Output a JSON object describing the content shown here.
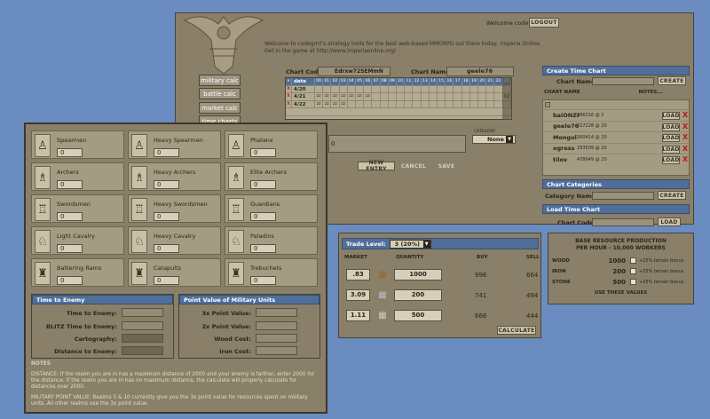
{
  "header": {
    "welcome_code_label": "Welcome code",
    "logout_label": "LOGOUT",
    "intro_line1": "Welcome to codegrrrl's strategy tools for the best web-based MMORPG out there today, Imperia Online.",
    "intro_line2": "Get in the game at http://www.imperiaonline.org/"
  },
  "nav": {
    "items": [
      "military calc",
      "battle calc",
      "market calc",
      "time charts"
    ]
  },
  "chart_editor": {
    "chart_code_label": "Chart Code:",
    "chart_code_value": "Edrxw72SEMmN",
    "chart_name_label": "Chart Name:",
    "chart_name_value": "geele76",
    "grid_head_x": "x",
    "grid_head_date": "date",
    "hours": [
      "00",
      "01",
      "02",
      "03",
      "04",
      "05",
      "06",
      "07",
      "08",
      "09",
      "10",
      "11",
      "12",
      "13",
      "14",
      "15",
      "16",
      "17",
      "18",
      "19",
      "20",
      "21",
      "22",
      "23"
    ],
    "rows": [
      {
        "date": "4/20",
        "marks": "",
        "note": ""
      },
      {
        "date": "4/21",
        "marks": "ZZZZZZZ",
        "note": "12"
      },
      {
        "date": "4/22",
        "marks": "ZZZZ",
        "note": ""
      }
    ],
    "notes_value": "0",
    "category_label": "CATEGORY",
    "category_value": "None",
    "new_entry_label": "NEW ENTRY",
    "cancel_label": "CANCEL",
    "save_label": "SAVE"
  },
  "time_chart_panel": {
    "create_title": "Create Time Chart",
    "chart_name_label": "Chart Name:",
    "create_label": "CREATE",
    "col_chart_name": "CHART NAME",
    "col_notes": "NOTES...",
    "load_label": "LOAD",
    "charts": [
      {
        "name": "baiONZI",
        "value": "486316 @ 2"
      },
      {
        "name": "geele76",
        "value": "227228 @ 20"
      },
      {
        "name": "Mongol",
        "value": "260414 @ 20"
      },
      {
        "name": "ogress",
        "value": "183509 @ 20"
      },
      {
        "name": "tilov",
        "value": "478049 @ 20"
      }
    ],
    "categories_title": "Chart Categories",
    "category_name_label": "Category Name:",
    "load_title": "Load Time Chart",
    "chart_code_label": "Chart Code:"
  },
  "military": {
    "units": [
      {
        "name": "Spearmen",
        "value": "0"
      },
      {
        "name": "Heavy Spearmen",
        "value": "0"
      },
      {
        "name": "Phalanx",
        "value": "0"
      },
      {
        "name": "Archers",
        "value": "0"
      },
      {
        "name": "Heavy Archers",
        "value": "0"
      },
      {
        "name": "Elite Archers",
        "value": "0"
      },
      {
        "name": "Swordsmen",
        "value": "0"
      },
      {
        "name": "Heavy Swordsmen",
        "value": "0"
      },
      {
        "name": "Guardians",
        "value": "0"
      },
      {
        "name": "Light Cavalry",
        "value": "0"
      },
      {
        "name": "Heavy Cavalry",
        "value": "0"
      },
      {
        "name": "Paladins",
        "value": "0"
      },
      {
        "name": "Battering Rams",
        "value": "0"
      },
      {
        "name": "Catapults",
        "value": "0"
      },
      {
        "name": "Trebuchets",
        "value": "0"
      }
    ],
    "time_title": "Time to Enemy",
    "time_labels": [
      "Time to Enemy:",
      "BLITZ Time to Enemy:",
      "Cartography:",
      "Distance to Enemy:"
    ],
    "points_title": "Point Value of Military Units",
    "points_labels": [
      "3x Point Value:",
      "2x Point Value:",
      "Wood Cost:",
      "Iron Cost:"
    ],
    "notes_title": "NOTES",
    "note1": "DISTANCE: If the realm you are in has a maximum distance of 2000 and your enemy is farther, enter 2000 for the distance. If the realm you are in has no maximum distance, the calculate will properly calculate for distances over 2000.",
    "note2": "MILITARY POINT VALUE: Realms 5 & 10 currently give you the 3x point value for resources spent on military units. All other realms use the 3x point value."
  },
  "trade": {
    "trade_level_label": "Trade Level:",
    "trade_level_value": "3 (20%)",
    "col_market": "MARKET",
    "col_quantity": "QUANTITY",
    "col_buy": "BUY",
    "col_sell": "SELL",
    "rows": [
      {
        "market": ".83",
        "icon": "wood-icon",
        "quantity": "1000",
        "buy": "996",
        "sell": "664"
      },
      {
        "market": "3.09",
        "icon": "iron-icon",
        "quantity": "200",
        "buy": "741",
        "sell": "494"
      },
      {
        "market": "1.11",
        "icon": "stone-icon",
        "quantity": "500",
        "buy": "666",
        "sell": "444"
      }
    ],
    "calculate_label": "CALCULATE"
  },
  "production": {
    "title_line1": "BASE RESOURCE PRODUCTION",
    "title_line2": "PER HOUR - 10,000 WORKERS",
    "rows": [
      {
        "name": "WOOD",
        "value": "1000",
        "bonus": "+25% terrain bonus"
      },
      {
        "name": "IRON",
        "value": "200",
        "bonus": "+25% terrain bonus"
      },
      {
        "name": "STONE",
        "value": "500",
        "bonus": "+25% terrain bonus"
      }
    ],
    "use_label": "USE THESE VALUES"
  }
}
